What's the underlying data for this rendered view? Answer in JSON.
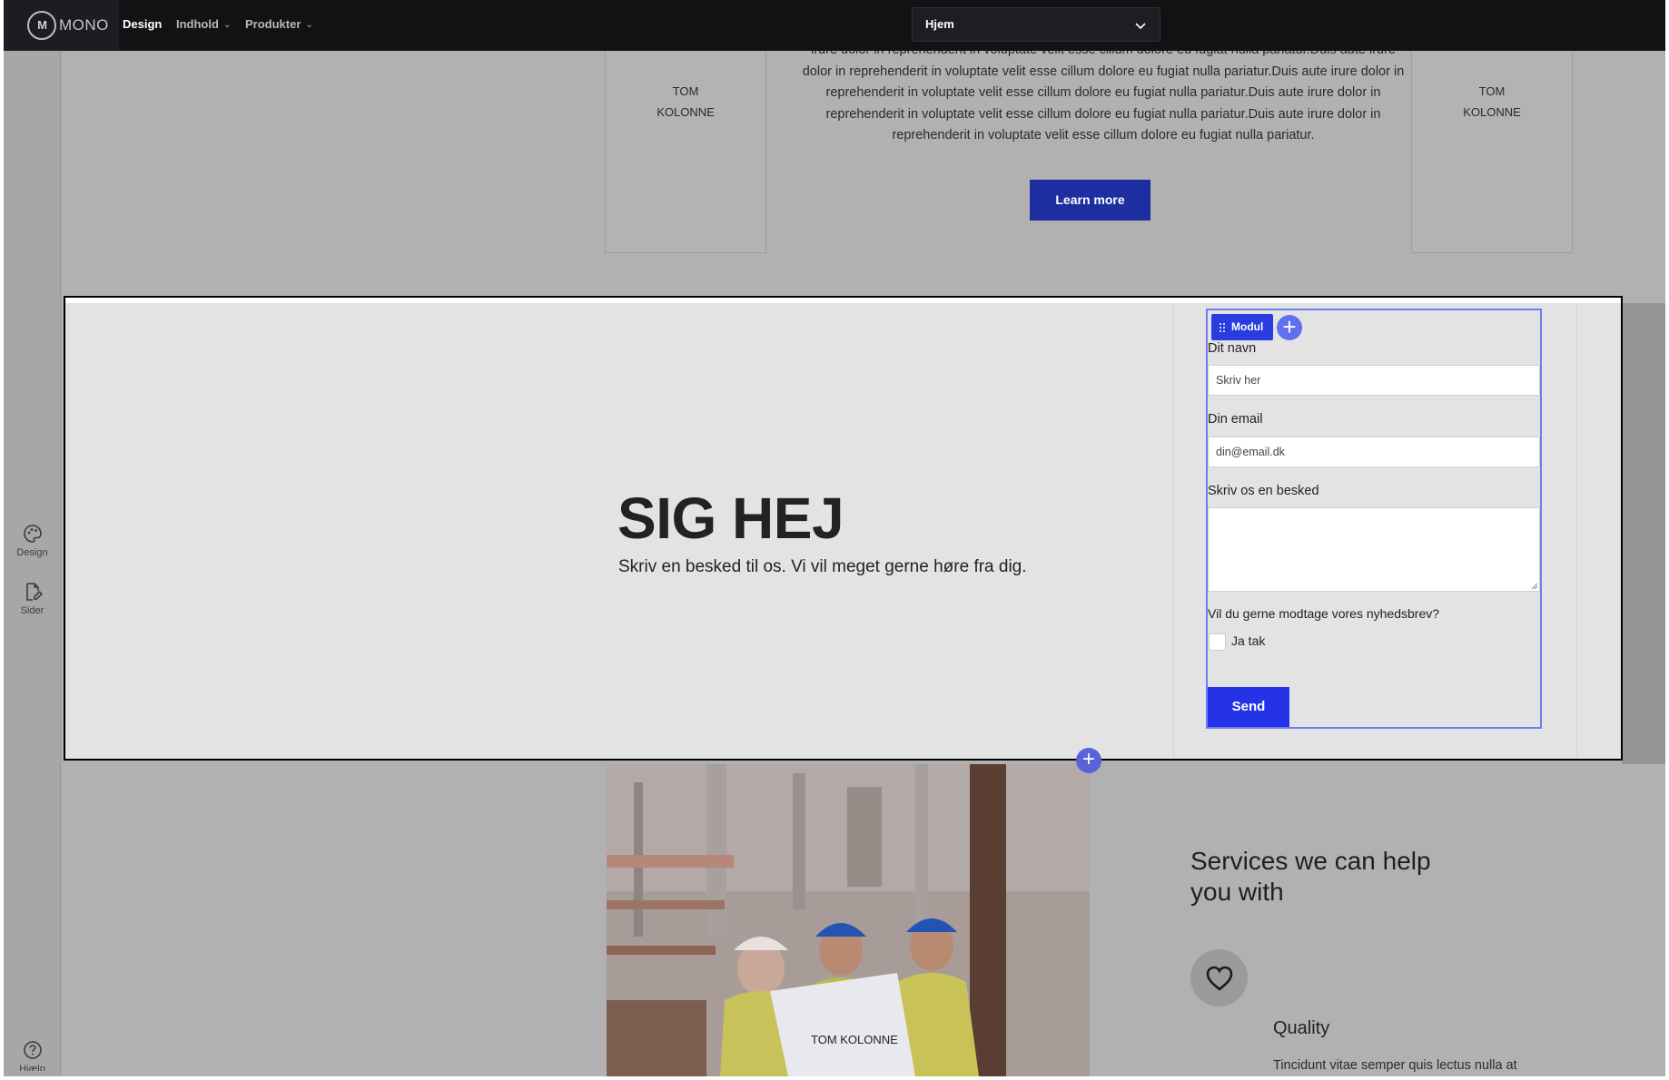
{
  "topbar": {
    "logo_mark": "M",
    "logo_text": "MONO",
    "nav": [
      {
        "label": "Design"
      },
      {
        "label": "Indhold"
      },
      {
        "label": "Produkter"
      }
    ],
    "page_select": "Hjem"
  },
  "sidebar": {
    "items": [
      {
        "label": "Design",
        "icon": "palette-icon"
      },
      {
        "label": "Sider",
        "icon": "page-edit-icon"
      }
    ],
    "help_label": "Hjælp"
  },
  "top_section": {
    "left_col": "TOM\nKOLONNE",
    "right_col": "TOM\nKOLONNE",
    "body_lines": [
      "irure dolor in reprehenderit in voluptate velit esse cillum dolore eu fugiat nulla pariatur.Duis aute irure",
      "dolor in reprehenderit in voluptate velit esse cillum dolore eu fugiat nulla pariatur.Duis aute irure dolor in",
      "reprehenderit in voluptate velit esse cillum dolore eu fugiat nulla pariatur.Duis aute irure dolor in",
      "reprehenderit in voluptate velit esse cillum dolore eu fugiat nulla pariatur.Duis aute irure dolor in",
      "reprehenderit in voluptate velit esse cillum dolore eu fugiat nulla pariatur."
    ],
    "button": "Learn more"
  },
  "contact_section": {
    "heading": "SIG HEJ",
    "subheading": "Skriv en besked til os. Vi vil meget gerne høre fra dig.",
    "module_tag": "Modul",
    "form": {
      "name_label": "Dit navn",
      "name_placeholder": "Skriv her",
      "email_label": "Din email",
      "email_placeholder": "din@email.dk",
      "message_label": "Skriv os en besked",
      "newsletter_label": "Vil du gerne modtage vores nyhedsbrev?",
      "checkbox_label": "Ja tak",
      "submit": "Send"
    }
  },
  "bottom_section": {
    "photo_label": "TOM KOLONNE",
    "services_title": "Services we can help you with",
    "service": {
      "title": "Quality",
      "description": "Tincidunt vitae semper quis lectus nulla at volutpat. Eget velit aliquet sagittis id.",
      "icon": "heart-icon"
    }
  },
  "colors": {
    "topbar_bg": "#111214",
    "primary_button": "#2433e6",
    "learn_more_button": "#1d2ea0",
    "module_outline": "#6b7ef0"
  }
}
